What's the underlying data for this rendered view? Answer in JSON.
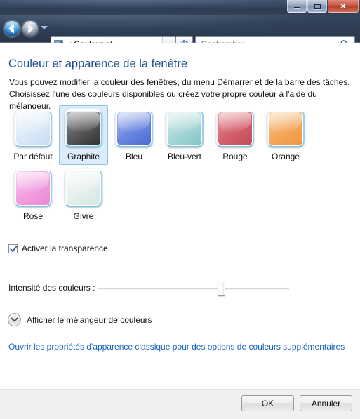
{
  "window": {
    "controls": {
      "minimize_label": "Réduire",
      "maximize_label": "Agrandir",
      "close_label": "Fermer",
      "close_glyph": "✕"
    }
  },
  "navbar": {
    "back_label": "Précédent",
    "forward_label": "Suivant",
    "recent_pages_label": "Pages récentes",
    "address": {
      "chevron": "«",
      "text": "Couleur et...",
      "dropdown_label": "Précédents emplacements"
    },
    "refresh_label": "Actualiser",
    "search": {
      "placeholder": "Rechercher",
      "value": "",
      "icon": "search-icon"
    }
  },
  "main": {
    "title": "Couleur et apparence de la fenêtre",
    "description": "Vous pouvez modifier la couleur des fenêtres, du menu Démarrer et de la barre des tâches. Choisissez l'une des couleurs disponibles ou créez votre propre couleur à l'aide du mélangeur.",
    "swatches": [
      {
        "label": "Par défaut",
        "color": "#dbeaf8",
        "top": "#f3f9fd",
        "bottom": "#c7dcf0",
        "selected": false
      },
      {
        "label": "Graphite",
        "color": "#5a5a5a",
        "top": "#8f8f8f",
        "bottom": "#2e2e2e",
        "selected": true
      },
      {
        "label": "Bleu",
        "color": "#6b88e0",
        "top": "#b7c6f2",
        "bottom": "#4a6bd4",
        "selected": false
      },
      {
        "label": "Bleu-vert",
        "color": "#a8d6d6",
        "top": "#d9eeed",
        "bottom": "#83c4c6",
        "selected": false
      },
      {
        "label": "Rouge",
        "color": "#d4626e",
        "top": "#e8a0a6",
        "bottom": "#c24a58",
        "selected": false
      },
      {
        "label": "Orange",
        "color": "#f4a95c",
        "top": "#fad3a4",
        "bottom": "#f09440",
        "selected": false
      },
      {
        "label": "Rose",
        "color": "#f2a0e0",
        "top": "#fbd4f3",
        "bottom": "#ea85d4",
        "selected": false
      },
      {
        "label": "Givre",
        "color": "#e6f0ee",
        "top": "#f7fbfa",
        "bottom": "#d5e6e3",
        "selected": false
      }
    ],
    "transparency": {
      "label": "Activer la transparence",
      "checked": true
    },
    "intensity": {
      "label": "Intensité des couleurs :",
      "value": 65,
      "min": 0,
      "max": 100
    },
    "mixer": {
      "label": "Afficher le mélangeur de couleurs",
      "icon": "chevron-down-icon",
      "expanded": false
    },
    "classic_link": "Ouvrir les propriétés d'apparence classique pour des options de couleurs supplémentaires"
  },
  "footer": {
    "ok_label": "OK",
    "cancel_label": "Annuler"
  },
  "theme": {
    "accent": "#1b4f8f",
    "link": "#1262c4",
    "selection_bg": "#dcecfa",
    "selection_border": "#8cc3e8"
  }
}
